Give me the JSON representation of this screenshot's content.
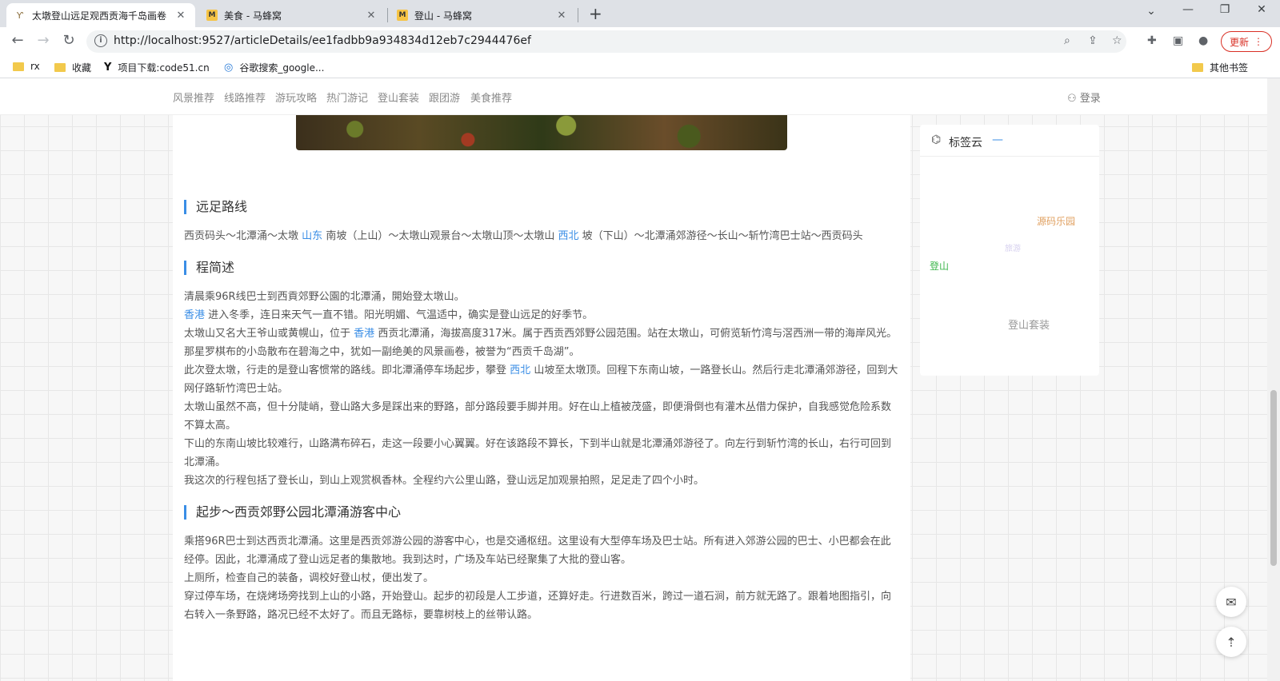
{
  "browser": {
    "tabs": [
      {
        "title": "太墩登山远足观西贡海千岛画卷",
        "active": true
      },
      {
        "title": "美食 - 马蜂窝",
        "active": false
      },
      {
        "title": "登山 - 马蜂窝",
        "active": false
      }
    ],
    "url": "http://localhost:9527/articleDetails/ee1fadbb9a934834d12eb7c2944476ef",
    "update_label": "更新",
    "bookmarks": [
      {
        "label": "rx"
      },
      {
        "label": "收藏"
      },
      {
        "label": "项目下载:code51.cn"
      },
      {
        "label": "谷歌搜索_google..."
      }
    ],
    "other_bookmarks": "其他书签"
  },
  "nav": {
    "items": [
      "风景推荐",
      "线路推荐",
      "游玩攻略",
      "热门游记",
      "登山套装",
      "跟团游",
      "美食推荐"
    ],
    "login": "登录"
  },
  "article": {
    "s1_title": "远足路线",
    "route": {
      "a": "西贡码头～北潭涌～太墩",
      "k1": "山东",
      "b": "南坡（上山）～太墩山观景台～太墩山顶～太墩山",
      "k2": "西北",
      "c": "坡（下山）～北潭涌郊游径～长山～斩竹湾巴士站～西贡码头"
    },
    "s2_title": "程简述",
    "p1": "清晨乘96R线巴士到西貢郊野公園的北潭涌，開始登太墩山。",
    "p2": {
      "k": "香港",
      "t": "进入冬季，连日来天气一直不错。阳光明媚、气温适中，确实是登山远足的好季节。"
    },
    "p3": {
      "a": "太墩山又名大王爷山或黄幌山，位于",
      "k": "香港",
      "b": "西贡北潭涌，海拔高度317米。属于西贡西郊野公园范围。站在太墩山，可俯览斩竹湾与滘西洲一带的海岸风光。那星罗棋布的小岛散布在碧海之中，犹如一副绝美的风景画卷，被誉为“西贡千岛湖”。"
    },
    "p4": {
      "a": "此次登太墩，行走的是登山客惯常的路线。即北潭涌停车场起步，攀登",
      "k": "西北",
      "b": "山坡至太墩顶。回程下东南山坡，一路登长山。然后行走北潭涌郊游径，回到大网仔路斩竹湾巴士站。"
    },
    "p5": "太墩山虽然不高，但十分陡峭，登山路大多是踩出来的野路，部分路段要手脚并用。好在山上植被茂盛，即便滑倒也有灌木丛借力保护，自我感觉危险系数不算太高。",
    "p6": "下山的东南山坡比较难行，山路满布碎石，走这一段要小心翼翼。好在该路段不算长，下到半山就是北潭涌郊游径了。向左行到斩竹湾的长山，右行可回到北潭涌。",
    "p7": "我这次的行程包括了登长山，到山上观赏枫香林。全程约六公里山路，登山远足加观景拍照，足足走了四个小时。",
    "s3_title": "起步～西贡郊野公园北潭涌游客中心",
    "p8": "乘搭96R巴士到达西贡北潭涌。这里是西贡郊游公园的游客中心，也是交通枢纽。这里设有大型停车场及巴士站。所有进入郊游公园的巴士、小巴都会在此经停。因此，北潭涌成了登山远足者的集散地。我到达时，广场及车站已经聚集了大批的登山客。",
    "p9": "上厕所，检查自己的装备，调校好登山杖，便出发了。",
    "p10": "穿过停车场，在烧烤场旁找到上山的小路，开始登山。起步的初段是人工步道，还算好走。行进数百米，跨过一道石涧，前方就无路了。跟着地图指引，向右转入一条野路，路况已经不太好了。而且无路标，要靠树枝上的丝带认路。"
  },
  "tagcloud": {
    "title": "标签云",
    "collapse": "—",
    "tags": [
      {
        "label": "源码乐园",
        "color": "#e0a060"
      },
      {
        "label": "旅游",
        "color": "#d6d0ef"
      },
      {
        "label": "登山",
        "color": "#3bb54a"
      },
      {
        "label": "登山套装",
        "color": "#9a9a9a"
      }
    ]
  }
}
